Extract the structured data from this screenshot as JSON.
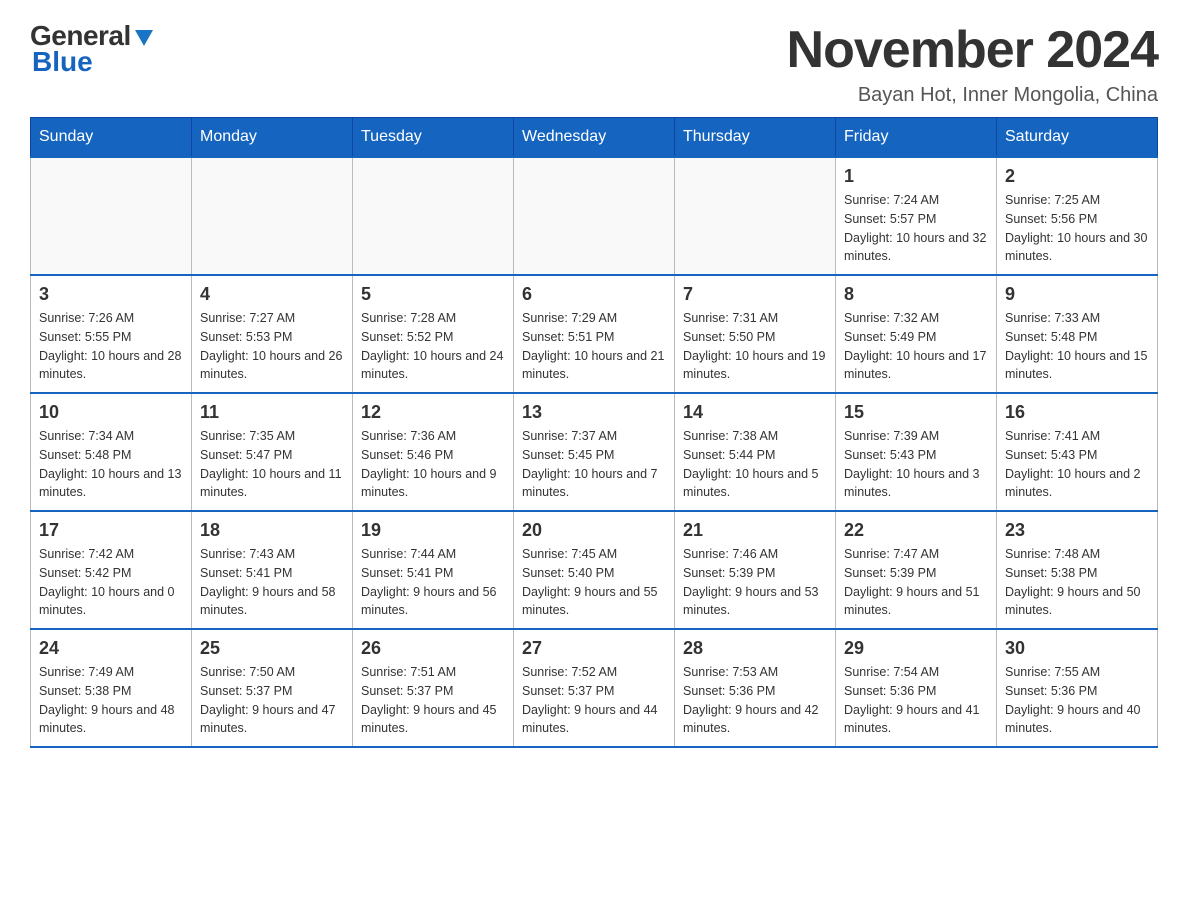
{
  "logo": {
    "general": "General",
    "blue": "Blue"
  },
  "title": "November 2024",
  "location": "Bayan Hot, Inner Mongolia, China",
  "days_of_week": [
    "Sunday",
    "Monday",
    "Tuesday",
    "Wednesday",
    "Thursday",
    "Friday",
    "Saturday"
  ],
  "weeks": [
    [
      {
        "day": "",
        "info": ""
      },
      {
        "day": "",
        "info": ""
      },
      {
        "day": "",
        "info": ""
      },
      {
        "day": "",
        "info": ""
      },
      {
        "day": "",
        "info": ""
      },
      {
        "day": "1",
        "info": "Sunrise: 7:24 AM\nSunset: 5:57 PM\nDaylight: 10 hours and 32 minutes."
      },
      {
        "day": "2",
        "info": "Sunrise: 7:25 AM\nSunset: 5:56 PM\nDaylight: 10 hours and 30 minutes."
      }
    ],
    [
      {
        "day": "3",
        "info": "Sunrise: 7:26 AM\nSunset: 5:55 PM\nDaylight: 10 hours and 28 minutes."
      },
      {
        "day": "4",
        "info": "Sunrise: 7:27 AM\nSunset: 5:53 PM\nDaylight: 10 hours and 26 minutes."
      },
      {
        "day": "5",
        "info": "Sunrise: 7:28 AM\nSunset: 5:52 PM\nDaylight: 10 hours and 24 minutes."
      },
      {
        "day": "6",
        "info": "Sunrise: 7:29 AM\nSunset: 5:51 PM\nDaylight: 10 hours and 21 minutes."
      },
      {
        "day": "7",
        "info": "Sunrise: 7:31 AM\nSunset: 5:50 PM\nDaylight: 10 hours and 19 minutes."
      },
      {
        "day": "8",
        "info": "Sunrise: 7:32 AM\nSunset: 5:49 PM\nDaylight: 10 hours and 17 minutes."
      },
      {
        "day": "9",
        "info": "Sunrise: 7:33 AM\nSunset: 5:48 PM\nDaylight: 10 hours and 15 minutes."
      }
    ],
    [
      {
        "day": "10",
        "info": "Sunrise: 7:34 AM\nSunset: 5:48 PM\nDaylight: 10 hours and 13 minutes."
      },
      {
        "day": "11",
        "info": "Sunrise: 7:35 AM\nSunset: 5:47 PM\nDaylight: 10 hours and 11 minutes."
      },
      {
        "day": "12",
        "info": "Sunrise: 7:36 AM\nSunset: 5:46 PM\nDaylight: 10 hours and 9 minutes."
      },
      {
        "day": "13",
        "info": "Sunrise: 7:37 AM\nSunset: 5:45 PM\nDaylight: 10 hours and 7 minutes."
      },
      {
        "day": "14",
        "info": "Sunrise: 7:38 AM\nSunset: 5:44 PM\nDaylight: 10 hours and 5 minutes."
      },
      {
        "day": "15",
        "info": "Sunrise: 7:39 AM\nSunset: 5:43 PM\nDaylight: 10 hours and 3 minutes."
      },
      {
        "day": "16",
        "info": "Sunrise: 7:41 AM\nSunset: 5:43 PM\nDaylight: 10 hours and 2 minutes."
      }
    ],
    [
      {
        "day": "17",
        "info": "Sunrise: 7:42 AM\nSunset: 5:42 PM\nDaylight: 10 hours and 0 minutes."
      },
      {
        "day": "18",
        "info": "Sunrise: 7:43 AM\nSunset: 5:41 PM\nDaylight: 9 hours and 58 minutes."
      },
      {
        "day": "19",
        "info": "Sunrise: 7:44 AM\nSunset: 5:41 PM\nDaylight: 9 hours and 56 minutes."
      },
      {
        "day": "20",
        "info": "Sunrise: 7:45 AM\nSunset: 5:40 PM\nDaylight: 9 hours and 55 minutes."
      },
      {
        "day": "21",
        "info": "Sunrise: 7:46 AM\nSunset: 5:39 PM\nDaylight: 9 hours and 53 minutes."
      },
      {
        "day": "22",
        "info": "Sunrise: 7:47 AM\nSunset: 5:39 PM\nDaylight: 9 hours and 51 minutes."
      },
      {
        "day": "23",
        "info": "Sunrise: 7:48 AM\nSunset: 5:38 PM\nDaylight: 9 hours and 50 minutes."
      }
    ],
    [
      {
        "day": "24",
        "info": "Sunrise: 7:49 AM\nSunset: 5:38 PM\nDaylight: 9 hours and 48 minutes."
      },
      {
        "day": "25",
        "info": "Sunrise: 7:50 AM\nSunset: 5:37 PM\nDaylight: 9 hours and 47 minutes."
      },
      {
        "day": "26",
        "info": "Sunrise: 7:51 AM\nSunset: 5:37 PM\nDaylight: 9 hours and 45 minutes."
      },
      {
        "day": "27",
        "info": "Sunrise: 7:52 AM\nSunset: 5:37 PM\nDaylight: 9 hours and 44 minutes."
      },
      {
        "day": "28",
        "info": "Sunrise: 7:53 AM\nSunset: 5:36 PM\nDaylight: 9 hours and 42 minutes."
      },
      {
        "day": "29",
        "info": "Sunrise: 7:54 AM\nSunset: 5:36 PM\nDaylight: 9 hours and 41 minutes."
      },
      {
        "day": "30",
        "info": "Sunrise: 7:55 AM\nSunset: 5:36 PM\nDaylight: 9 hours and 40 minutes."
      }
    ]
  ]
}
